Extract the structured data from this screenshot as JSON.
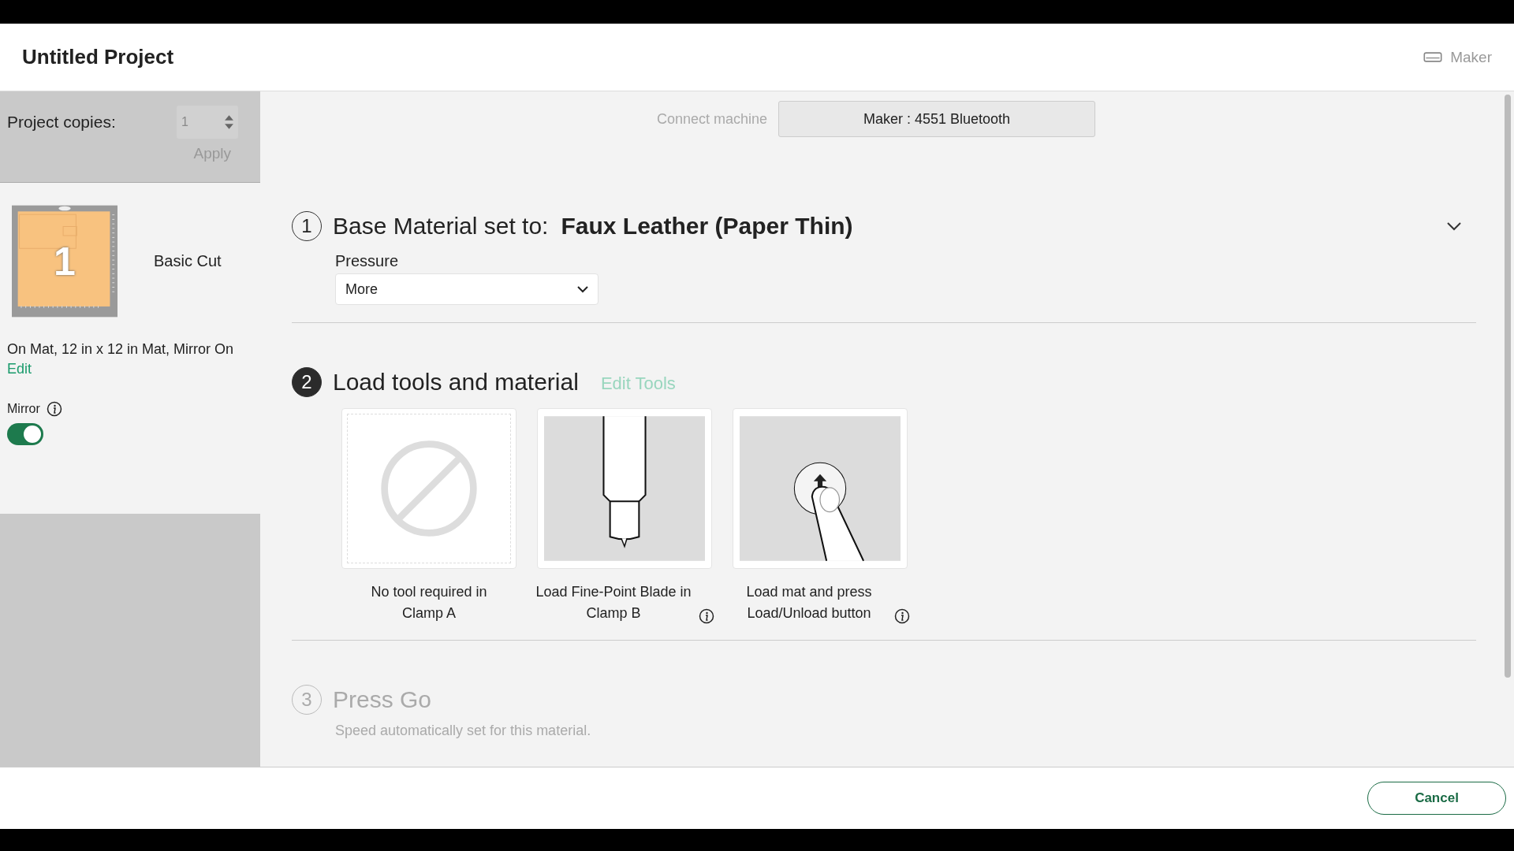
{
  "window": {
    "title": "Untitled Project",
    "machine": "Maker"
  },
  "sidebar": {
    "copies_label": "Project copies:",
    "copies_value": "1",
    "copies_disabled": true,
    "apply": "Apply",
    "apply_disabled": true,
    "mat": {
      "number": "1",
      "name": "Basic Cut",
      "description": "On Mat, 12 in x 12 in Mat, Mirror On",
      "edit": "Edit"
    },
    "mirror": {
      "label": "Mirror",
      "on": true
    }
  },
  "connect": {
    "label": "Connect machine",
    "device": "Maker : 4551 Bluetooth"
  },
  "steps": [
    {
      "number": "1",
      "current": false,
      "disabled": false,
      "title": "Base Material set to:",
      "value": "Faux Leather (Paper Thin)",
      "pressure_label": "Pressure",
      "pressure": "More"
    },
    {
      "number": "2",
      "current": true,
      "disabled": false,
      "title": "Load tools and material",
      "link": "Edit Tools",
      "tools": [
        {
          "kind": "none",
          "caption": "No tool required in Clamp A",
          "info": false
        },
        {
          "kind": "blade",
          "caption": "Load Fine-Point Blade in Clamp B",
          "info": true
        },
        {
          "kind": "load",
          "caption": "Load mat and press Load/Unload button",
          "info": true
        }
      ]
    },
    {
      "number": "3",
      "current": false,
      "disabled": true,
      "title": "Press Go",
      "note": "Speed automatically set for this material."
    }
  ],
  "footer": {
    "cancel": "Cancel"
  }
}
